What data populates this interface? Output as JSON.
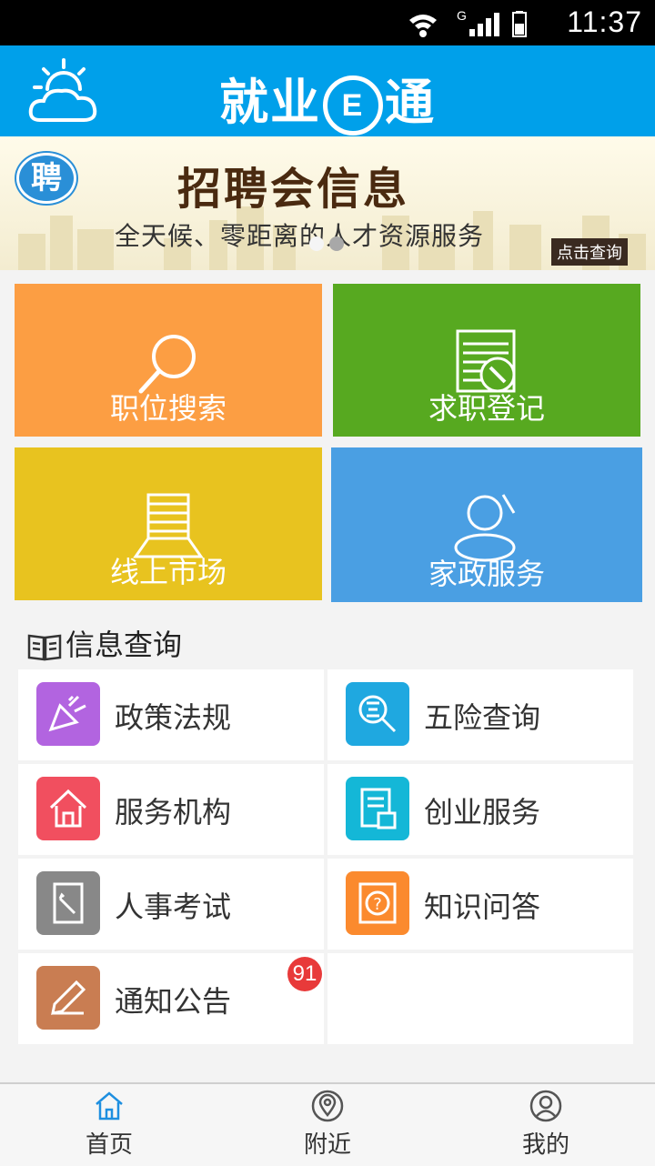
{
  "status_bar": {
    "time": "11:37",
    "network": "G"
  },
  "header": {
    "title_part1": "就业",
    "title_e": "E",
    "title_part2": "通",
    "weather_icon": "weather-cloud-sun-icon"
  },
  "banner": {
    "badge": "聘",
    "title": "招聘会信息",
    "subtitle": "全天候、零距离的人才资源服务",
    "button": "点击查询",
    "pages": 2,
    "active_page": 2
  },
  "tiles": [
    {
      "label": "职位搜索",
      "color": "#fc9e43",
      "icon": "magnifier-icon"
    },
    {
      "label": "求职登记",
      "color": "#57a920",
      "icon": "register-form-icon"
    },
    {
      "label": "线上市场",
      "color": "#e8c31f",
      "icon": "market-stack-icon"
    },
    {
      "label": "家政服务",
      "color": "#4a9fe3",
      "icon": "person-service-icon"
    }
  ],
  "section": {
    "title": "信息查询"
  },
  "info_items": [
    {
      "label": "政策法规",
      "color": "#b264e0",
      "icon": "megaphone-icon"
    },
    {
      "label": "五险查询",
      "color": "#1fa8e0",
      "icon": "insurance-search-icon"
    },
    {
      "label": "服务机构",
      "color": "#f14f5f",
      "icon": "home-icon"
    },
    {
      "label": "创业服务",
      "color": "#14b7d7",
      "icon": "startup-doc-icon"
    },
    {
      "label": "人事考试",
      "color": "#888888",
      "icon": "exam-pencil-icon"
    },
    {
      "label": "知识问答",
      "color": "#fb8a2e",
      "icon": "qa-question-icon"
    },
    {
      "label": "通知公告",
      "color": "#c97d52",
      "icon": "notice-pencil-icon",
      "badge": "91"
    }
  ],
  "tabbar": [
    {
      "label": "首页",
      "icon": "home-tab-icon",
      "active": true
    },
    {
      "label": "附近",
      "icon": "location-pin-icon",
      "active": false
    },
    {
      "label": "我的",
      "icon": "profile-icon",
      "active": false
    }
  ]
}
